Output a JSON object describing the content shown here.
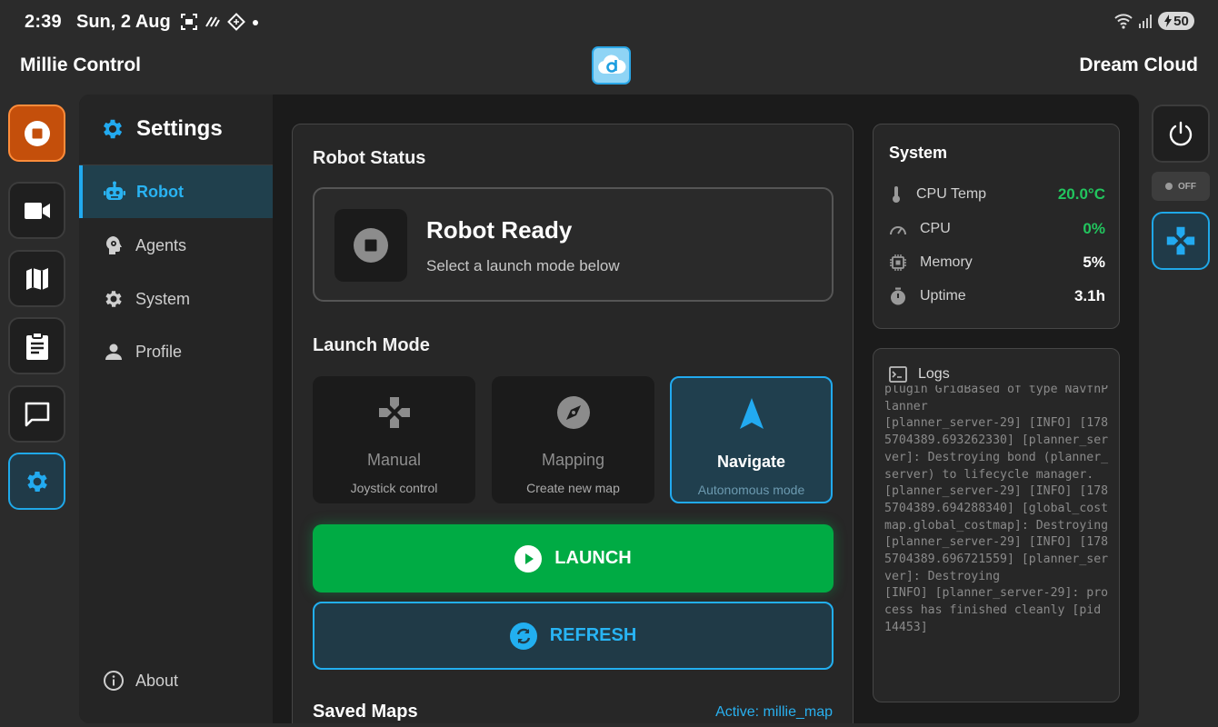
{
  "status_bar": {
    "time": "2:39",
    "date": "Sun, 2 Aug",
    "battery": "50"
  },
  "app_bar": {
    "title": "Millie Control",
    "right_title": "Dream Cloud"
  },
  "left_rail": {
    "items": [
      {
        "icon": "stop-icon",
        "state": "stop"
      },
      {
        "icon": "video-camera-icon"
      },
      {
        "icon": "map-icon"
      },
      {
        "icon": "clipboard-icon"
      },
      {
        "icon": "chat-icon"
      },
      {
        "icon": "gear-icon",
        "state": "active"
      }
    ]
  },
  "settings": {
    "title": "Settings",
    "items": [
      {
        "label": "Robot",
        "icon": "robot-icon",
        "active": true
      },
      {
        "label": "Agents",
        "icon": "agent-head-icon"
      },
      {
        "label": "System",
        "icon": "gear-icon"
      },
      {
        "label": "Profile",
        "icon": "person-icon"
      }
    ],
    "about": "About"
  },
  "robot": {
    "status_heading": "Robot Status",
    "status_title": "Robot Ready",
    "status_subtitle": "Select a launch mode below",
    "launch_mode_heading": "Launch Mode",
    "modes": [
      {
        "name": "Manual",
        "desc": "Joystick control",
        "icon": "gamepad-icon"
      },
      {
        "name": "Mapping",
        "desc": "Create new map",
        "icon": "compass-icon"
      },
      {
        "name": "Navigate",
        "desc": "Autonomous mode",
        "icon": "navigation-arrow-icon",
        "selected": true
      }
    ],
    "launch_label": "LAUNCH",
    "refresh_label": "REFRESH",
    "saved_maps_heading": "Saved Maps",
    "active_map": "Active: millie_map"
  },
  "system": {
    "title": "System",
    "rows": [
      {
        "label": "CPU Temp",
        "value": "20.0°C",
        "icon": "thermometer-icon"
      },
      {
        "label": "CPU",
        "value": "0%",
        "icon": "gauge-icon"
      },
      {
        "label": "Memory",
        "value": "5%",
        "icon": "chip-icon"
      },
      {
        "label": "Uptime",
        "value": "3.1h",
        "icon": "timer-icon"
      }
    ]
  },
  "logs": {
    "title": "Logs",
    "text": "plugin GridBased of type NavfnPlanner\n[planner_server-29] [INFO] [1785704389.693262330] [planner_server]: Destroying bond (planner_server) to lifecycle manager.\n[planner_server-29] [INFO] [1785704389.694288340] [global_costmap.global_costmap]: Destroying\n[planner_server-29] [INFO] [1785704389.696721559] [planner_server]: Destroying\n[INFO] [planner_server-29]: process has finished cleanly [pid 14453]"
  },
  "right_rail": {
    "power_icon": "power-icon",
    "toggle_label": "OFF",
    "gamepad_icon": "gamepad-icon"
  },
  "colors": {
    "accent": "#21aaf0",
    "launch_green": "#00ab44",
    "stop_orange": "#c44f0b",
    "value_green": "#22c55e"
  }
}
